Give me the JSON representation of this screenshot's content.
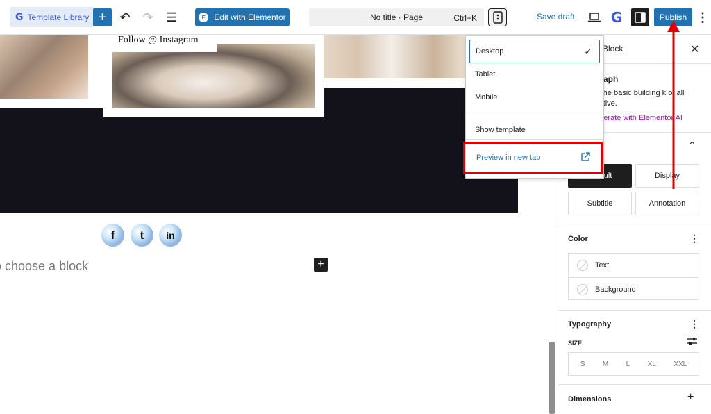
{
  "toolbar": {
    "template_library": "Template Library",
    "add": "+",
    "undo": "↶",
    "redo": "↷",
    "list_view": "☰",
    "edit_elementor": "Edit with Elementor",
    "document_title": "No title · Page",
    "shortcut": "Ctrl+K",
    "save_draft": "Save draft",
    "gk_logo": "G",
    "publish": "Publish",
    "more": "⋮"
  },
  "canvas": {
    "follow_label": "Follow @ Instagram",
    "social_icons": [
      "f",
      "t",
      "in"
    ],
    "placeholder": "o choose a block",
    "inserter": "+"
  },
  "dropdown": {
    "items": [
      "Desktop",
      "Tablet",
      "Mobile"
    ],
    "selected": "Desktop",
    "check": "✓",
    "show_template": "Show template",
    "preview_new_tab": "Preview in new tab"
  },
  "sidebar": {
    "tab_block": "Block",
    "close": "✕",
    "block_title": "graph",
    "block_desc": "with the basic building k of all narrative.",
    "ai_link": "enerate with Elementor AI",
    "collapse": "⌃",
    "styles": [
      "Default",
      "Display",
      "Subtitle",
      "Annotation"
    ],
    "active_style": "Default",
    "color_title": "Color",
    "color_items": [
      "Text",
      "Background"
    ],
    "typography_title": "Typography",
    "size_label": "SIZE",
    "sizes": [
      "S",
      "M",
      "L",
      "XL",
      "XXL"
    ],
    "dimensions_title": "Dimensions",
    "more": "⋮",
    "plus": "+"
  },
  "colors": {
    "accent": "#2271b1",
    "highlight": "#e00000",
    "ai": "#9b1ea8",
    "dark_band": "#13111a"
  }
}
